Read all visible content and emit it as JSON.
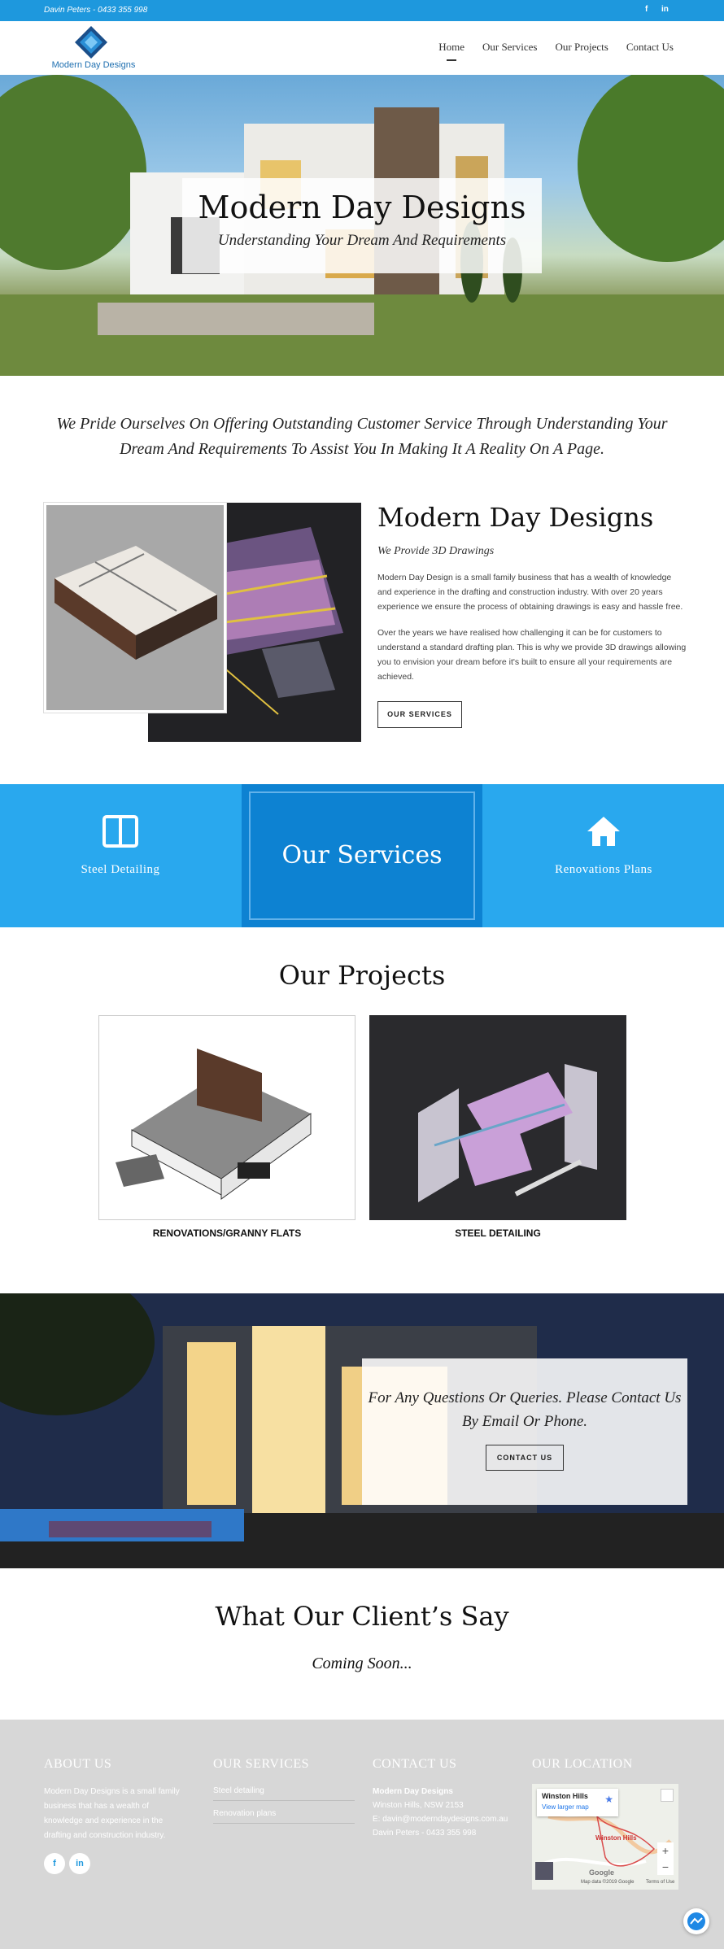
{
  "topbar": {
    "contact": "Davin Peters - 0433 355 998",
    "social": [
      "f",
      "in"
    ]
  },
  "header": {
    "logo_text": "Modern Day Designs",
    "nav": [
      {
        "label": "Home",
        "active": true
      },
      {
        "label": "Our Services",
        "active": false
      },
      {
        "label": "Our Projects",
        "active": false
      },
      {
        "label": "Contact Us",
        "active": false
      }
    ]
  },
  "hero": {
    "title": "Modern Day Designs",
    "subtitle": "Understanding Your Dream And Requirements"
  },
  "tagline": "We Pride Ourselves On Offering Outstanding Customer Service Through Understanding Your Dream And Requirements To Assist You In Making It A Reality On A Page.",
  "about": {
    "title": "Modern Day Designs",
    "subtitle": "We Provide 3D Drawings",
    "paragraph1": "Modern Day Design is a small family business that has a wealth of knowledge and experience in the drafting and construction industry. With over 20 years experience we ensure the process of obtaining drawings is easy and hassle free.",
    "paragraph2": "Over the years we have realised how challenging it can be for customers to understand a standard drafting plan. This is why we provide 3D drawings allowing you to envision your dream before it's built to ensure all your requirements are achieved.",
    "button": "OUR SERVICES"
  },
  "services": {
    "left": {
      "label": "Steel Detailing",
      "icon": "panel-icon"
    },
    "title": "Our Services",
    "right": {
      "label": "Renovations Plans",
      "icon": "home-icon"
    }
  },
  "projects": {
    "title": "Our Projects",
    "items": [
      {
        "label": "RENOVATIONS/GRANNY FLATS"
      },
      {
        "label": "STEEL DETAILING"
      }
    ]
  },
  "contact_band": {
    "text": "For Any Questions Or Queries. Please Contact Us By Email Or Phone.",
    "button": "CONTACT US"
  },
  "testimonials": {
    "title": "What Our Client’s Say",
    "subtitle": "Coming Soon..."
  },
  "footer": {
    "about": {
      "heading": "ABOUT US",
      "text": "Modern Day Designs is a small family business that has a wealth of knowledge and experience in the drafting and construction industry."
    },
    "services": {
      "heading": "OUR SERVICES",
      "links": [
        "Steel detailing",
        "Renovation plans"
      ]
    },
    "contact": {
      "heading": "CONTACT US",
      "name": "Modern Day Designs",
      "address": "Winston Hills, NSW 2153",
      "email": "E: davin@moderndaydesigns.com.au",
      "phone": "Davin Peters - 0433 355 998"
    },
    "location": {
      "heading": "OUR LOCATION",
      "map_title": "Winston Hills",
      "map_link": "View larger map",
      "map_place": "Winston Hills",
      "map_credit": "Map data ©2019 Google",
      "map_terms": "Terms of Use",
      "google": "Google"
    },
    "social": [
      "f",
      "in"
    ]
  },
  "colors": {
    "accent": "#1e98dd",
    "services_band": "#29a8ee",
    "services_mid": "#0d82d2",
    "footer_bg": "#d7d7d7"
  }
}
